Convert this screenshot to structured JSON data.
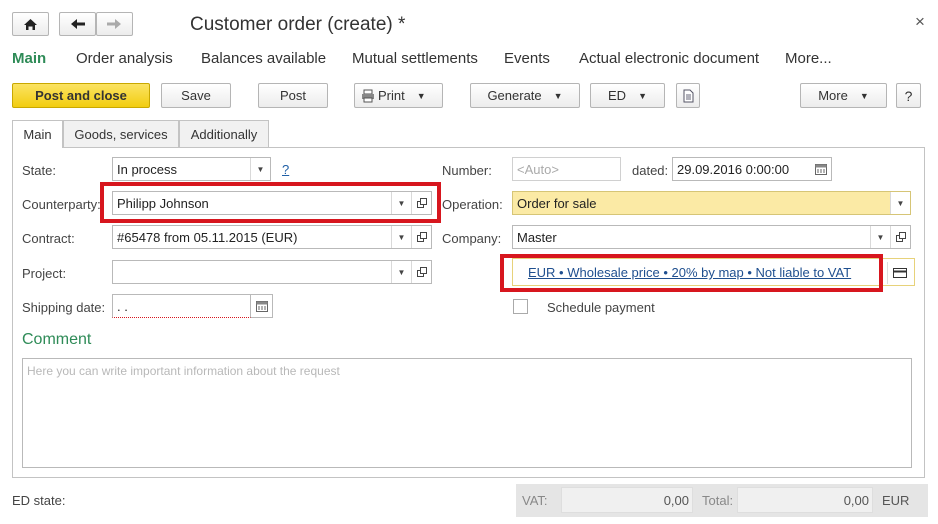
{
  "window": {
    "title": "Customer order (create) *",
    "close_glyph": "×"
  },
  "nav": {
    "tabs": [
      {
        "label": "Main"
      },
      {
        "label": "Order analysis"
      },
      {
        "label": "Balances available"
      },
      {
        "label": "Mutual settlements"
      },
      {
        "label": "Events"
      },
      {
        "label": "Actual electronic document"
      },
      {
        "label": "More..."
      }
    ]
  },
  "toolbar": {
    "post_close": "Post and close",
    "save": "Save",
    "post": "Post",
    "print": "Print",
    "generate": "Generate",
    "ed": "ED",
    "more": "More",
    "help": "?"
  },
  "subtabs": [
    {
      "label": "Main"
    },
    {
      "label": "Goods, services"
    },
    {
      "label": "Additionally"
    }
  ],
  "form": {
    "state_label": "State:",
    "state_value": "In process",
    "state_help": "?",
    "counterparty_label": "Counterparty:",
    "counterparty_value": "Philipp Johnson",
    "contract_label": "Contract:",
    "contract_value": "#65478 from 05.11.2015 (EUR)",
    "project_label": "Project:",
    "project_value": "",
    "shipping_label": "Shipping date:",
    "shipping_value": " .  .",
    "number_label": "Number:",
    "number_placeholder": "<Auto>",
    "dated_label": "dated:",
    "dated_value": "29.09.2016  0:00:00",
    "operation_label": "Operation:",
    "operation_value": "Order for sale",
    "company_label": "Company:",
    "company_value": "Master",
    "price_link": "EUR • Wholesale price • 20% by map • Not liable to VAT",
    "schedule_label": "Schedule payment",
    "schedule_checked": false
  },
  "comment": {
    "heading": "Comment",
    "placeholder": "Here you can write important information about the request"
  },
  "footer": {
    "ed_state_label": "ED state:",
    "vat_label": "VAT:",
    "vat_value": "0,00",
    "total_label": "Total:",
    "total_value": "0,00",
    "currency": "EUR"
  },
  "colors": {
    "accent_green": "#2e8b57",
    "post_button": "#f5d21f",
    "operation_bg": "#fbeaa5",
    "highlight_red": "#d7161e"
  },
  "icons": [
    "home-icon",
    "arrow-left-icon",
    "arrow-right-icon",
    "close-icon",
    "printer-icon",
    "document-icon",
    "calendar-icon",
    "open-icon",
    "card-icon"
  ]
}
